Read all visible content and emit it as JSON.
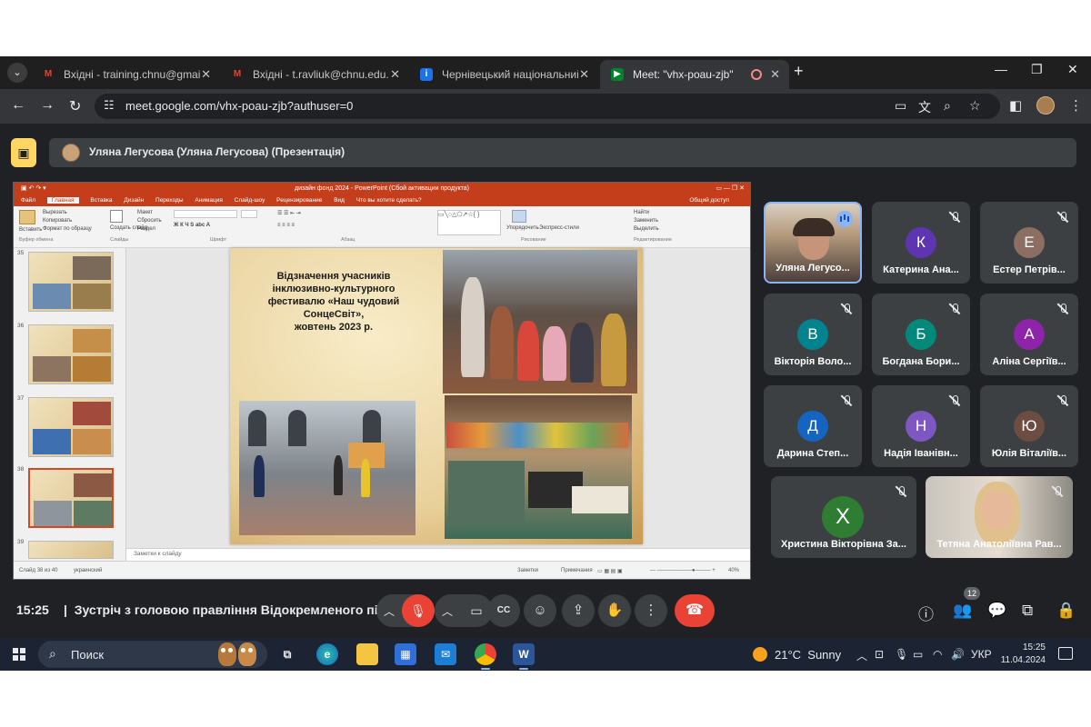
{
  "browser": {
    "tabs": [
      {
        "title": "Вхідні - training.chnu@gmail.com",
        "favicon": "gmail-icon",
        "active": false
      },
      {
        "title": "Вхідні - t.ravliuk@chnu.edu.ua",
        "favicon": "gmail-icon",
        "active": false
      },
      {
        "title": "Чернівецький національний університет",
        "favicon": "classroom-icon",
        "active": false
      },
      {
        "title": "Meet: \"vhx-poau-zjb\"",
        "favicon": "meet-icon",
        "active": true
      }
    ],
    "url": "meet.google.com/vhx-poau-zjb?authuser=0"
  },
  "meet": {
    "presenter_label": "Уляна Легусова (Уляна Легусова) (Презентація)",
    "meeting_time": "15:25",
    "meeting_title": "Зустріч з головою правління Відокремленого підр...",
    "participants_count": "12",
    "participants": [
      {
        "name": "Уляна Легусо...",
        "initial": "",
        "color": "#8d6b49",
        "video": true,
        "speaking": true
      },
      {
        "name": "Катерина Ана...",
        "initial": "К",
        "color": "#5e35b1",
        "video": false
      },
      {
        "name": "Естер Петрів...",
        "initial": "Е",
        "color": "#8d6e63",
        "video": false
      },
      {
        "name": "Вікторія Воло...",
        "initial": "В",
        "color": "#00838f",
        "video": false
      },
      {
        "name": "Богдана Бори...",
        "initial": "Б",
        "color": "#00897b",
        "video": false
      },
      {
        "name": "Аліна Сергіїв...",
        "initial": "А",
        "color": "#8e24aa",
        "video": false
      },
      {
        "name": "Дарина Степ...",
        "initial": "Д",
        "color": "#1565c0",
        "video": false
      },
      {
        "name": "Надія Іванівн...",
        "initial": "Н",
        "color": "#7e57c2",
        "video": false
      },
      {
        "name": "Юлія Віталіїв...",
        "initial": "Ю",
        "color": "#6d4c41",
        "video": false
      },
      {
        "name": "Христина Вікторівна За...",
        "initial": "Х",
        "color": "#2e7d32",
        "video": false
      },
      {
        "name": "Тетяна Анатоліївна Рав...",
        "initial": "",
        "color": "#c9b49a",
        "video": true
      }
    ]
  },
  "powerpoint": {
    "window_title": "дизайн фонд 2024 - PowerPoint (Сбой активации продукта)",
    "menu": [
      "Файл",
      "Главная",
      "Вставка",
      "Дизайн",
      "Переходы",
      "Анимация",
      "Слайд-шоу",
      "Рецензирование",
      "Вид",
      "Что вы хотите сделать?"
    ],
    "share_label": "Общий доступ",
    "ribbon_groups": [
      "Буфер обмена",
      "Слайды",
      "Шрифт",
      "Абзац",
      "Рисование",
      "Редактирование"
    ],
    "ribbon_items": {
      "paste": "Вставить",
      "cut": "Вырезать",
      "copy": "Копировать",
      "format_painter": "Формат по образцу",
      "new_slide": "Создать слайд",
      "layout": "Макет",
      "reset": "Сбросить",
      "section": "Раздел",
      "arrange": "Упорядочить",
      "quick_styles": "Экспресс-стили",
      "find": "Найти",
      "replace": "Заменить",
      "select": "Выделить"
    },
    "slide_numbers": [
      "35",
      "36",
      "37",
      "38",
      "39"
    ],
    "selected_slide": "38",
    "slide_title": "Відзначення учасників\nінклюзивно-культурного\nфестивалю «Наш чудовий\nСонцеСвіт»,\nжовтень 2023 р.",
    "notes_placeholder": "Заметки к слайду",
    "status_slide": "Слайд 38 из 40",
    "status_lang": "украинский",
    "status_notes": "Заметки",
    "status_comments": "Примечания",
    "zoom": "40%"
  },
  "taskbar": {
    "search_label": "Поиск",
    "temperature": "21°C",
    "weather": "Sunny",
    "lang": "УКР",
    "time": "15:25",
    "date": "11.04.2024"
  }
}
